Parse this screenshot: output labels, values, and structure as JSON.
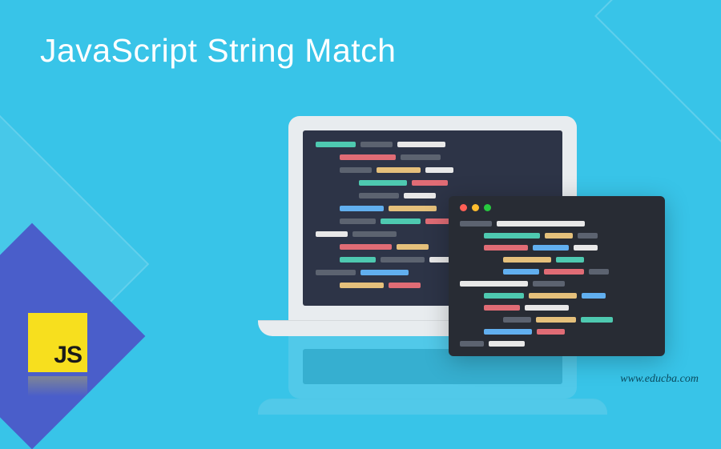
{
  "title": "JavaScript String Match",
  "url": "www.educba.com",
  "logo": {
    "label": "JS"
  },
  "colors": {
    "background": "#38c4e8",
    "laptop_frame": "#e8ecef",
    "laptop_screen": "#2d3447",
    "editor_bg": "#282c34",
    "accent_square": "#4a5eca",
    "js_logo_bg": "#f7df1e",
    "js_logo_text": "#1a1a1a"
  },
  "editor_window": {
    "dots": [
      "#ff5f56",
      "#ffbd2e",
      "#27c93f"
    ]
  },
  "code_colors": {
    "teal": "#4ec9b0",
    "white": "#e8e8e8",
    "red": "#e06c75",
    "yellow": "#e5c07b",
    "gray": "#5c6370",
    "blue": "#61afef"
  }
}
